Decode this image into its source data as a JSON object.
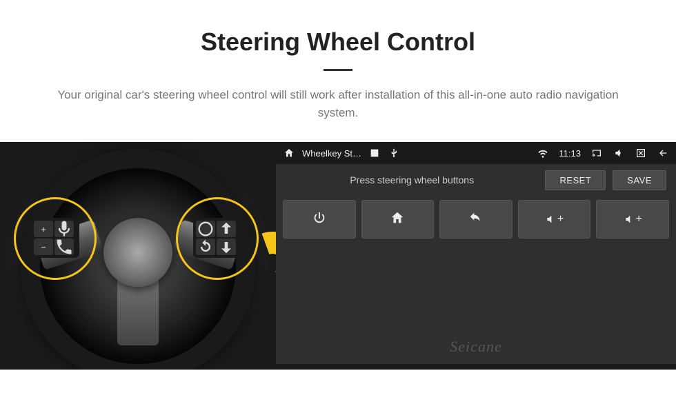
{
  "header": {
    "title": "Steering Wheel Control",
    "description": "Your original car's steering wheel control will still work after installation of this all-in-one auto radio navigation system."
  },
  "wheel": {
    "left_buttons": [
      "+",
      "voice",
      "−",
      "phone"
    ],
    "right_buttons": [
      "media",
      "up",
      "cycle",
      "down"
    ]
  },
  "screen": {
    "status_bar": {
      "app_title": "Wheelkey St…",
      "time": "11:13",
      "icons": {
        "home": "home-icon",
        "gallery": "gallery-icon",
        "usb": "usb-icon",
        "wifi": "wifi-icon",
        "cast": "cast-icon",
        "mute": "mute-icon",
        "close": "close-icon",
        "back": "back-icon"
      }
    },
    "action_bar": {
      "hint": "Press steering wheel buttons",
      "reset_label": "RESET",
      "save_label": "SAVE"
    },
    "function_buttons": [
      {
        "name": "power",
        "icon": "power-icon"
      },
      {
        "name": "home",
        "icon": "home-icon"
      },
      {
        "name": "back",
        "icon": "back-icon"
      },
      {
        "name": "volup1",
        "label": "🔊+"
      },
      {
        "name": "volup2",
        "label": "🔊+"
      }
    ],
    "watermark": "Seicane"
  }
}
